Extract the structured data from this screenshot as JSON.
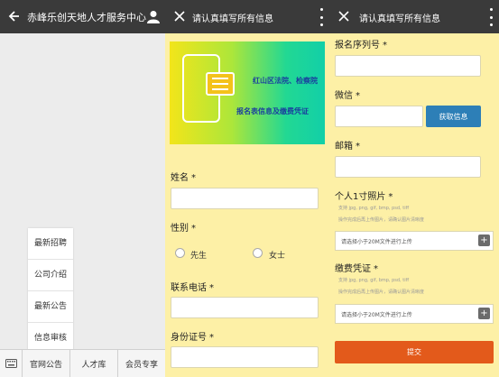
{
  "panel1": {
    "title": "赤峰乐创天地人才服务中心",
    "icons": {
      "back": "back-arrow-icon",
      "user": "user-icon",
      "keyboard": "keyboard-icon"
    },
    "menu_items": [
      "最新招聘",
      "公司介绍",
      "最新公告",
      "信息审核"
    ],
    "bottom_tabs": [
      "官网公告",
      "人才库",
      "会员专享"
    ]
  },
  "panel2": {
    "title": "请认真填写所有信息",
    "icons": {
      "close": "close-icon",
      "more": "more-icon"
    },
    "banner": {
      "line1": "红山区法院、检察院",
      "line2": "报名表信息及缴费凭证"
    },
    "fields": {
      "name": "姓名",
      "gender": "性别",
      "gender_male": "先生",
      "gender_female": "女士",
      "phone": "联系电话",
      "id": "身份证号"
    },
    "required_mark": "*"
  },
  "panel3": {
    "title": "请认真填写所有信息",
    "icons": {
      "close": "close-icon",
      "more": "more-icon"
    },
    "fields": {
      "serial": "报名序列号",
      "wechat": "微信",
      "email": "邮箱",
      "photo": "个人1寸照片",
      "payment": "缴费凭证"
    },
    "get_info_button": "获取信息",
    "hint_formats": "支持 jpg, png, gif, bmp, psd, tiff",
    "hint_upload": "操作完成后再上传图片，请确认图片清晰度",
    "upload_placeholder": "请选择小于20M文件进行上传",
    "plus": "+",
    "submit": "提交",
    "required_mark": "*"
  }
}
